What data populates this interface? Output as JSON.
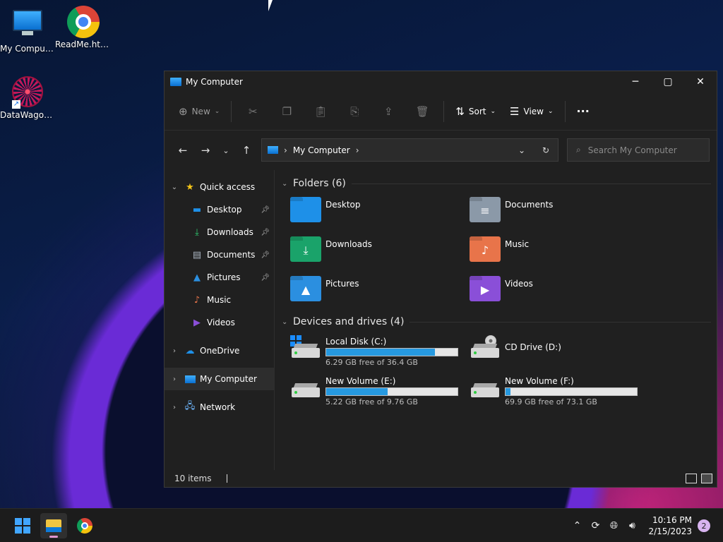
{
  "desktop": {
    "icons": [
      {
        "label": "My Computer",
        "icon": "monitor-icon"
      },
      {
        "label": "ReadMe.html",
        "icon": "chrome-icon"
      },
      {
        "label": "DataWagon...",
        "icon": "datawagon-icon"
      }
    ]
  },
  "window": {
    "title": "My Computer",
    "controls": {
      "minimize": "─",
      "maximize": "▢",
      "close": "✕"
    },
    "toolbar": {
      "new_label": "New",
      "sort_label": "Sort",
      "view_label": "View",
      "more_label": "···"
    },
    "address": {
      "path": "My Computer"
    },
    "search": {
      "placeholder": "Search My Computer"
    },
    "sidebar": {
      "quick_access": "Quick access",
      "quick_items": [
        {
          "label": "Desktop",
          "icon": "desktop-icon",
          "pinned": true
        },
        {
          "label": "Downloads",
          "icon": "downloads-icon",
          "pinned": true
        },
        {
          "label": "Documents",
          "icon": "documents-icon",
          "pinned": true
        },
        {
          "label": "Pictures",
          "icon": "pictures-icon",
          "pinned": true
        },
        {
          "label": "Music",
          "icon": "music-icon",
          "pinned": false
        },
        {
          "label": "Videos",
          "icon": "videos-icon",
          "pinned": false
        }
      ],
      "onedrive": "OneDrive",
      "my_computer": "My Computer",
      "network": "Network"
    },
    "folders_header": "Folders (6)",
    "folders": [
      {
        "name": "Desktop",
        "color": "#1e90e8",
        "glyph": ""
      },
      {
        "name": "Documents",
        "color": "#8b99a8",
        "glyph": "≡"
      },
      {
        "name": "Downloads",
        "color": "#1aa36a",
        "glyph": "⤓"
      },
      {
        "name": "Music",
        "color": "#e8744a",
        "glyph": "♪"
      },
      {
        "name": "Pictures",
        "color": "#2b8fe0",
        "glyph": "▲"
      },
      {
        "name": "Videos",
        "color": "#8a4fd8",
        "glyph": "▶"
      }
    ],
    "drives_header": "Devices and drives (4)",
    "drives": [
      {
        "name": "Local Disk (C:)",
        "free": "6.29 GB free of 36.4 GB",
        "used_fraction": 0.83,
        "type": "system"
      },
      {
        "name": "CD Drive (D:)",
        "free": "",
        "used_fraction": null,
        "type": "cd"
      },
      {
        "name": "New Volume (E:)",
        "free": "5.22 GB free of 9.76 GB",
        "used_fraction": 0.47,
        "type": "volume"
      },
      {
        "name": "New Volume (F:)",
        "free": "69.9 GB free of 73.1 GB",
        "used_fraction": 0.04,
        "type": "volume"
      }
    ],
    "status": {
      "items": "10 items"
    }
  },
  "taskbar": {
    "clock_time": "10:16 PM",
    "clock_date": "2/15/2023",
    "notification_count": "2"
  }
}
